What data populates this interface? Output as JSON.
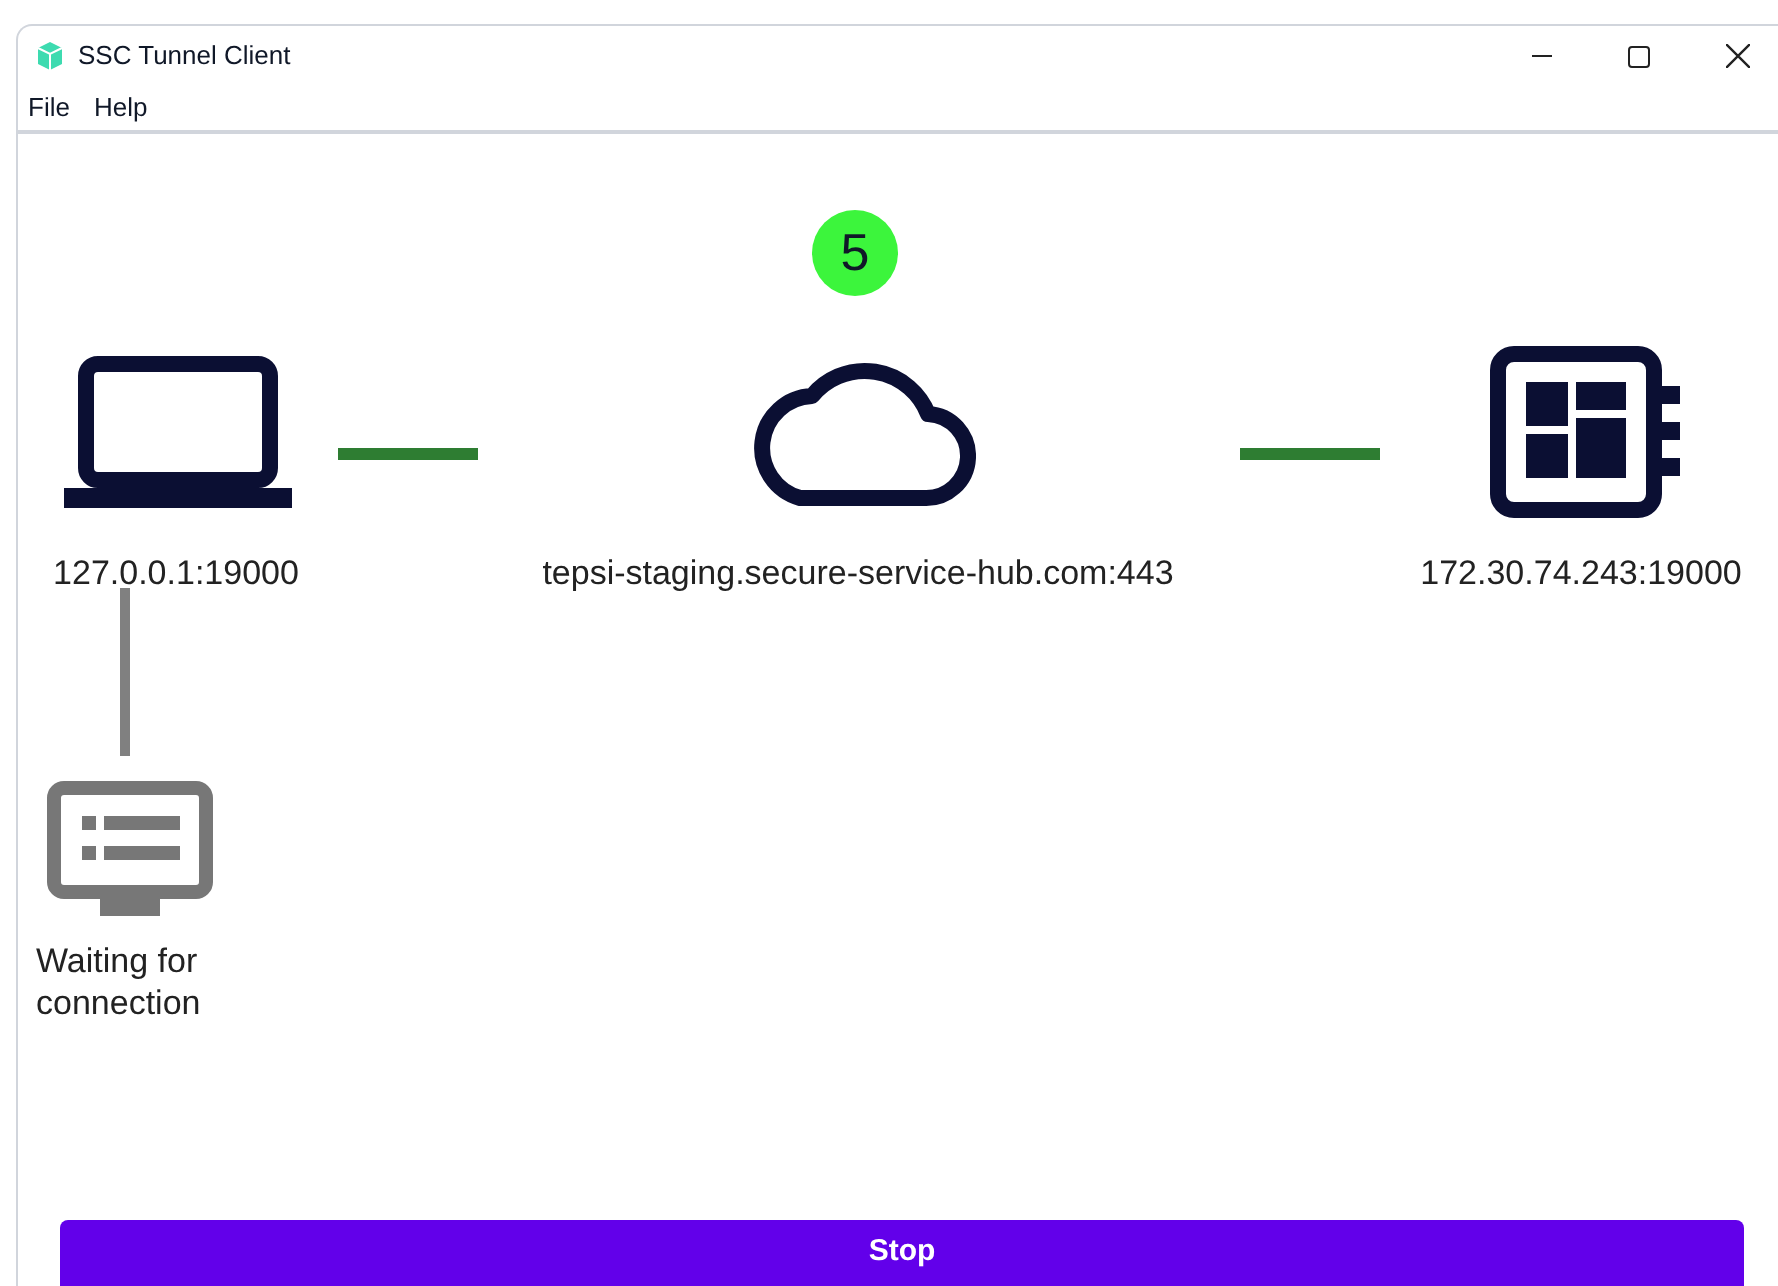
{
  "window": {
    "title": "SSC Tunnel Client"
  },
  "menu": [
    "File",
    "Help"
  ],
  "badge": "5",
  "nodes": [
    {
      "kind": "laptop",
      "label": "127.0.0.1:19000"
    },
    {
      "kind": "cloud",
      "label": "tepsi-staging.secure-service-hub.com:443"
    },
    {
      "kind": "server",
      "label": "172.30.74.243:19000"
    },
    {
      "kind": "client",
      "label": "Waiting for connection"
    }
  ],
  "links": [
    {
      "connected": true
    },
    {
      "connected": true
    },
    {
      "connected": false
    }
  ],
  "button": "Stop"
}
